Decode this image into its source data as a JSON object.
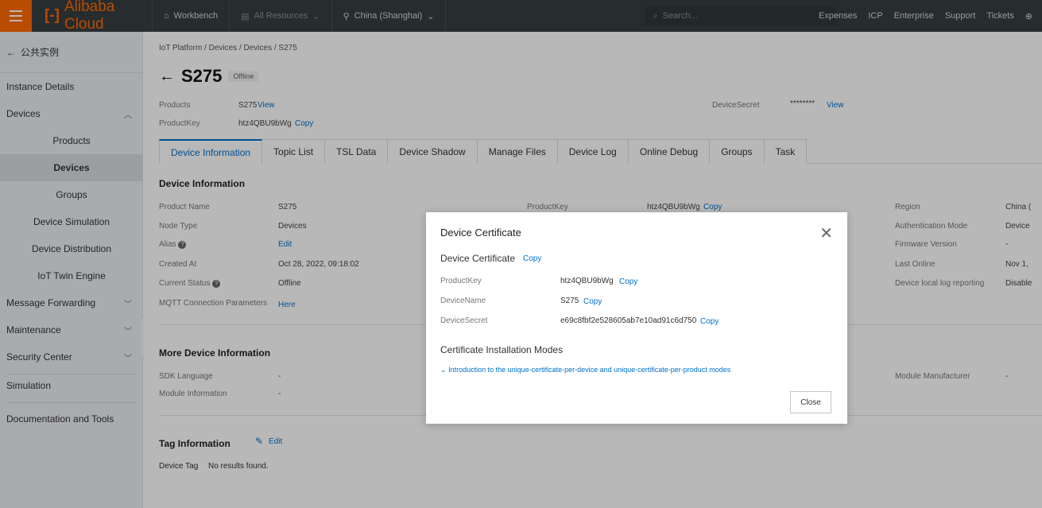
{
  "topbar": {
    "logo": "Alibaba Cloud",
    "workbench": "Workbench",
    "all_resources": "All Resources",
    "region": "China (Shanghai)",
    "search_placeholder": "Search...",
    "right": [
      "Expenses",
      "ICP",
      "Enterprise",
      "Support",
      "Tickets"
    ]
  },
  "sidebar": {
    "back": "公共实例",
    "instance_details": "Instance Details",
    "devices": "Devices",
    "products": "Products",
    "devices_sub": "Devices",
    "groups": "Groups",
    "device_simulation": "Device Simulation",
    "device_distribution": "Device Distribution",
    "iot_twin": "IoT Twin Engine",
    "message_forwarding": "Message Forwarding",
    "maintenance": "Maintenance",
    "security_center": "Security Center",
    "simulation": "Simulation",
    "doc_tools": "Documentation and Tools"
  },
  "main": {
    "breadcrumb": "IoT Platform / Devices / Devices / S275",
    "title": "S275",
    "status_badge": "Offline",
    "products_label": "Products",
    "products_value": "S275",
    "view": "View",
    "productkey_label": "ProductKey",
    "productkey_value": "htz4QBU9bWg",
    "copy": "Copy",
    "devicesecret_label": "DeviceSecret",
    "devicesecret_value": "********",
    "tabs": [
      "Device Information",
      "Topic List",
      "TSL Data",
      "Device Shadow",
      "Manage Files",
      "Device Log",
      "Online Debug",
      "Groups",
      "Task"
    ],
    "device_info_title": "Device Information",
    "info_left": [
      {
        "label": "Product Name",
        "value": "S275"
      },
      {
        "label": "Node Type",
        "value": "Devices"
      },
      {
        "label": "Alias",
        "value": "Edit"
      },
      {
        "label": "Created At",
        "value": "Oct 28, 2022, 09:18:02"
      },
      {
        "label": "Current Status",
        "value": "Offline"
      },
      {
        "label": "MQTT Connection Parameters",
        "value": "Here"
      }
    ],
    "info_mid": {
      "label": "ProductKey",
      "value": "htz4QBU9bWg",
      "copy": "Copy"
    },
    "info_right": [
      {
        "label": "Region",
        "value": "China ("
      },
      {
        "label": "Authentication Mode",
        "value": "Device"
      },
      {
        "label": "Firmware Version",
        "value": "-"
      },
      {
        "label": "Last Online",
        "value": "Nov 1,"
      },
      {
        "label": "Device local log reporting",
        "value": "Disable"
      }
    ],
    "more_info_title": "More Device Information",
    "sdk_language_label": "SDK Language",
    "sdk_language_value": "-",
    "module_info_label": "Module Information",
    "module_info_value": "-",
    "module_manufacturer_label": "Module Manufacturer",
    "module_manufacturer_value": "-",
    "tag_title": "Tag Information",
    "tag_edit": "Edit",
    "device_tag_label": "Device Tag",
    "device_tag_value": "No results found."
  },
  "modal": {
    "title": "Device Certificate",
    "cert_heading": "Device Certificate",
    "copy": "Copy",
    "rows": [
      {
        "label": "ProductKey",
        "value": "htz4QBU9bWg"
      },
      {
        "label": "DeviceName",
        "value": "S275"
      },
      {
        "label": "DeviceSecret",
        "value": "e69c8fbf2e528605ab7e10ad91c6d750"
      }
    ],
    "modes_heading": "Certificate Installation Modes",
    "modes_link": "Introduction to the unique-certificate-per-device and unique-certificate-per-product modes",
    "close_button": "Close"
  }
}
